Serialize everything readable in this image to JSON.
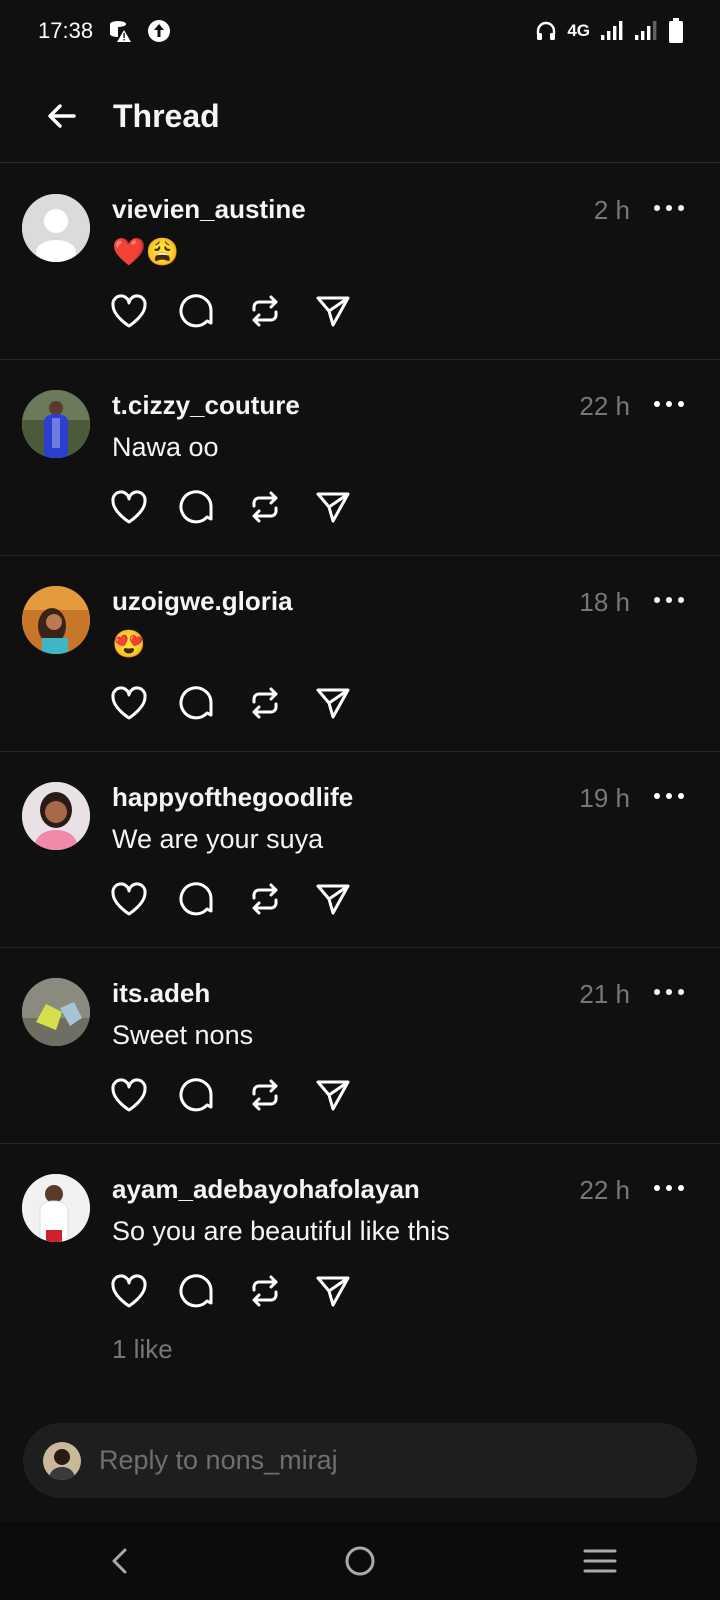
{
  "status_bar": {
    "time": "17:38",
    "network": "4G",
    "icons": [
      "data-warning-icon",
      "upload-icon",
      "headphones-icon",
      "signal-icon",
      "signal-icon",
      "battery-icon"
    ]
  },
  "header": {
    "title": "Thread",
    "back_icon": "arrow-left-icon"
  },
  "replies": [
    {
      "username": "vievien_austine",
      "time": "2 h",
      "text": "❤️😩",
      "avatar": "default-avatar"
    },
    {
      "username": "t.cizzy_couture",
      "time": "22 h",
      "text": "Nawa oo",
      "avatar": "photo-blue"
    },
    {
      "username": "uzoigwe.gloria",
      "time": "18 h",
      "text": "😍",
      "avatar": "photo-orange"
    },
    {
      "username": "happyofthegoodlife",
      "time": "19 h",
      "text": "We are your suya",
      "avatar": "photo-pink"
    },
    {
      "username": "its.adeh",
      "time": "21 h",
      "text": "Sweet nons",
      "avatar": "photo-grey"
    },
    {
      "username": "ayam_adebayohafolayan",
      "time": "22 h",
      "text": "So you are beautiful like this",
      "avatar": "photo-white",
      "likes": "1 like"
    }
  ],
  "composer": {
    "placeholder": "Reply to nons_miraj"
  },
  "nav": {
    "icons": [
      "back-icon",
      "home-icon",
      "menu-icon"
    ]
  },
  "colors": {
    "background": "#101010",
    "muted": "#777777",
    "text": "#f3f5f7"
  }
}
